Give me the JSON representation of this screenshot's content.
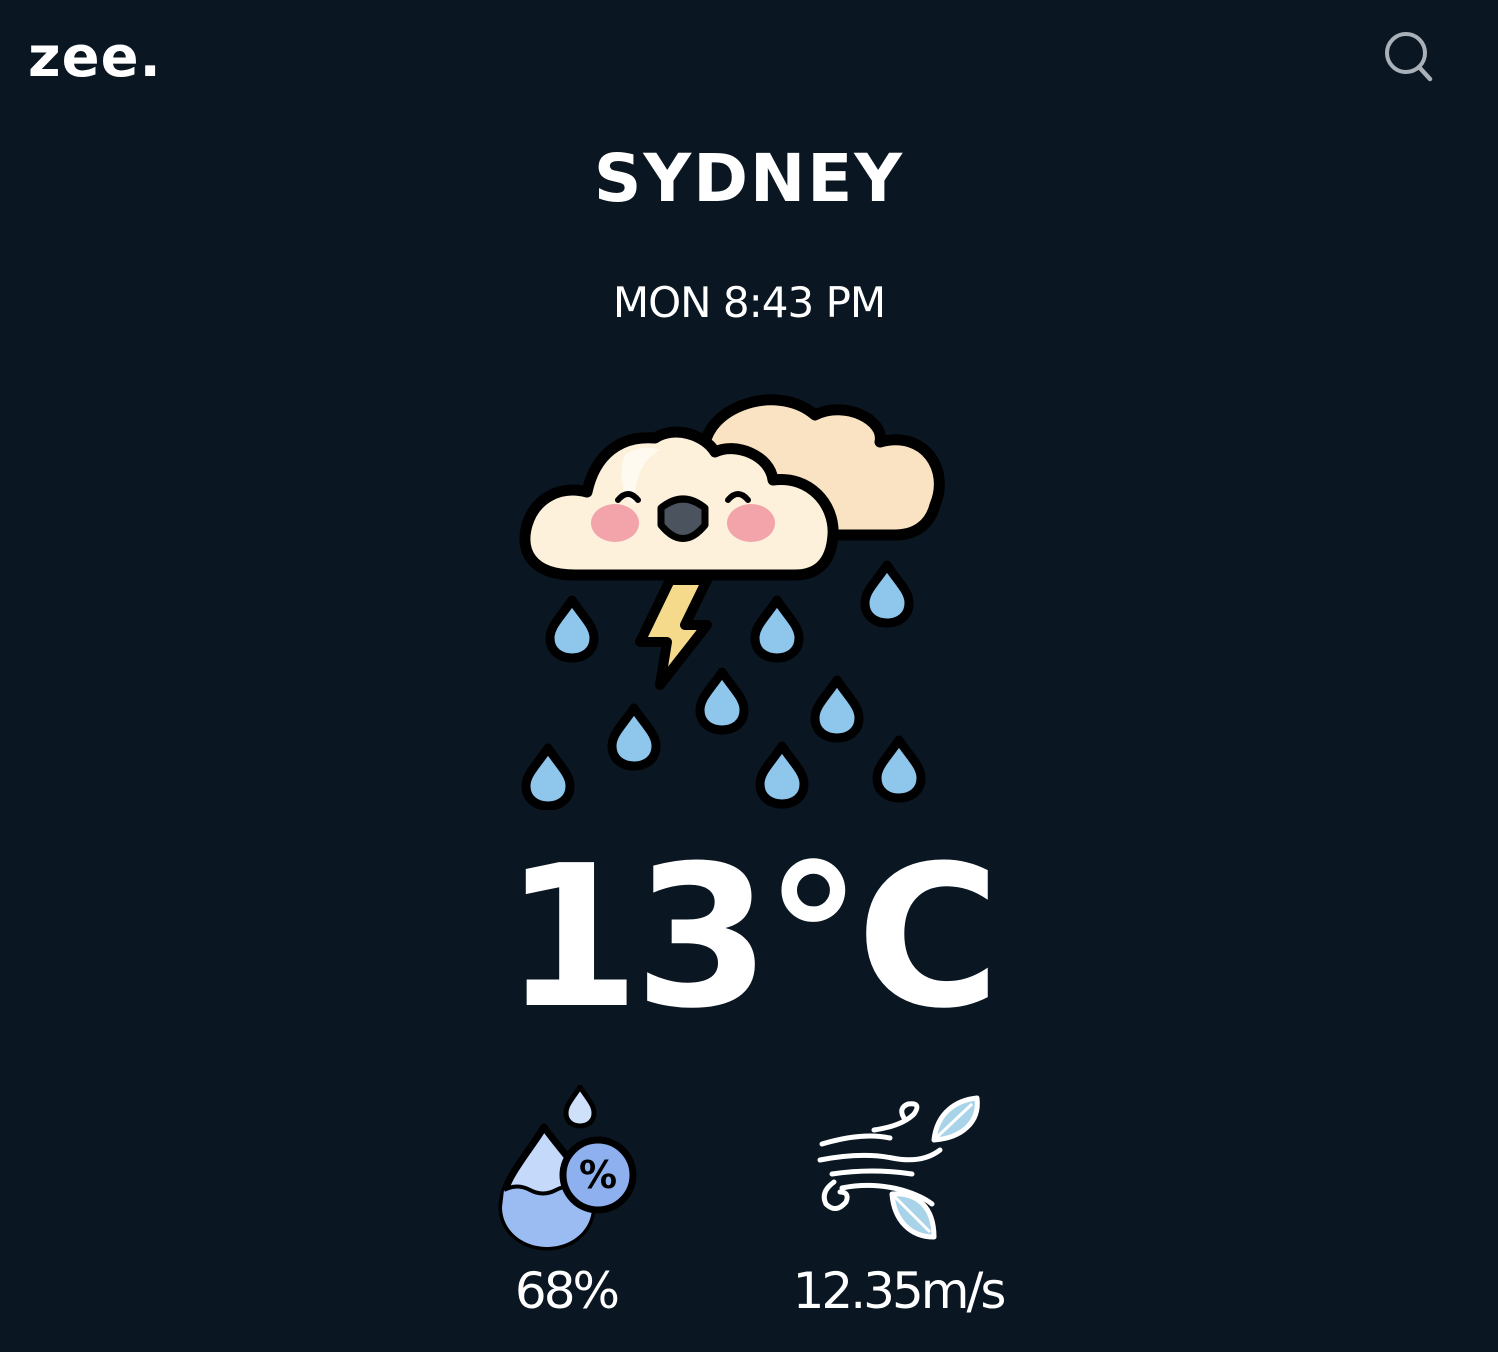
{
  "header": {
    "logo": "zee.",
    "search_icon": "search-icon"
  },
  "location": {
    "city": "SYDNEY",
    "datetime": "MON 8:43 PM"
  },
  "current": {
    "condition_icon": "thunderstorm-rain-icon",
    "temperature": "13°C"
  },
  "stats": {
    "humidity": {
      "icon": "humidity-icon",
      "value": "68%"
    },
    "wind": {
      "icon": "wind-icon",
      "value": "12.35m/s"
    }
  },
  "colors": {
    "background": "#0a1722",
    "text": "#ffffff",
    "cloud": "#fdf1dc",
    "cloud_back": "#f9e0bd",
    "raindrop": "#8ec6ec",
    "lightning": "#f6da8c",
    "blush": "#f3a3aa",
    "humidity_blue": "#9bbcf3"
  }
}
